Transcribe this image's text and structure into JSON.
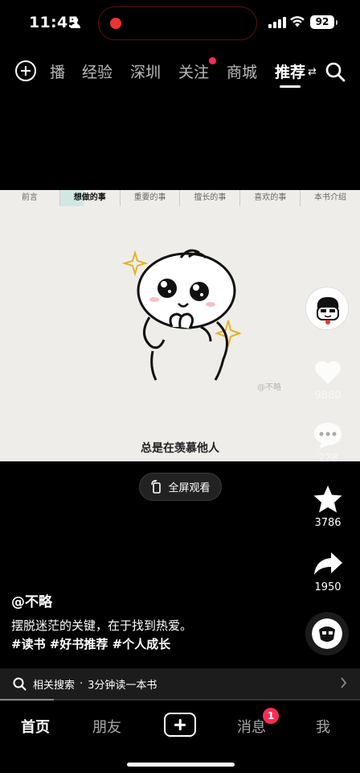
{
  "status_bar": {
    "time": "11:45",
    "battery": "92"
  },
  "top_nav": {
    "tabs": [
      {
        "label": "播"
      },
      {
        "label": "经验"
      },
      {
        "label": "深圳"
      },
      {
        "label": "关注"
      },
      {
        "label": "商城"
      },
      {
        "label": "推荐"
      }
    ],
    "active_tab": "推荐"
  },
  "video": {
    "chapters": [
      "前言",
      "想做的事",
      "重要的事",
      "擅长的事",
      "喜欢的事",
      "本书介绍"
    ],
    "active_chapter": "想做的事",
    "watermark": "@不略",
    "subtitle": "总是在羡慕他人",
    "fullscreen_label": "全屏观看"
  },
  "actions": {
    "likes": "9880",
    "comments": "228",
    "favorites": "3786",
    "shares": "1950"
  },
  "caption": {
    "author": "@不略",
    "text": "摆脱迷茫的关键，在于找到热爱。",
    "hashtags": "#读书 #好书推荐 #个人成长"
  },
  "related_search": {
    "prefix": "相关搜索",
    "separator": "·",
    "query": "3分钟读一本书"
  },
  "progress": {
    "fraction": 0.15
  },
  "bottom_tabs": {
    "home": "首页",
    "friends": "朋友",
    "messages": "消息",
    "me": "我",
    "message_badge": "1"
  },
  "colors": {
    "accent": "#fe2c55",
    "background": "#000000",
    "star": "#ffffff"
  }
}
